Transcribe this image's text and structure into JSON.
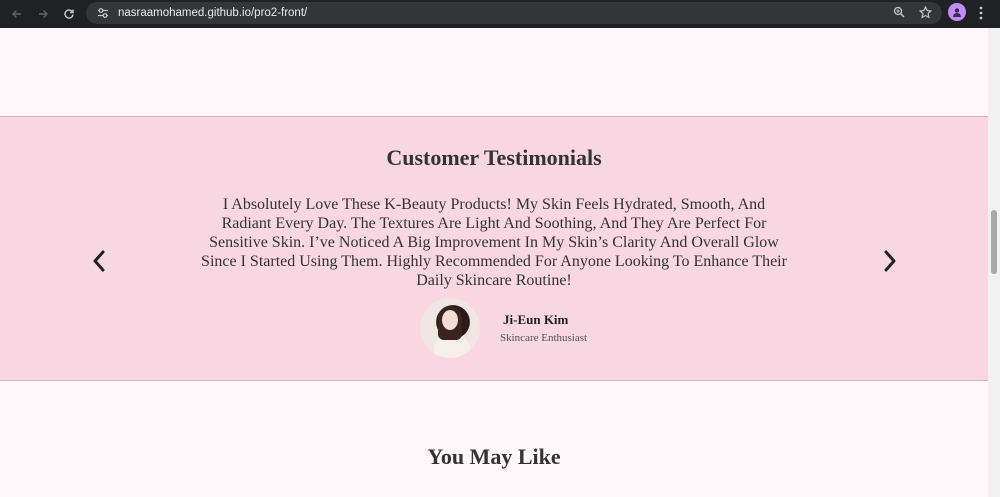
{
  "browser": {
    "url": "nasraamohamed.github.io/pro2-front/",
    "icons": {
      "back": "arrow-left-icon",
      "forward": "arrow-right-icon",
      "reload": "reload-icon",
      "site_info": "tune-icon",
      "zoom": "zoom-icon",
      "bookmark": "star-icon",
      "profile": "profile-icon",
      "menu": "kebab-menu-icon"
    },
    "colors": {
      "frame": "#202124",
      "omnibox": "#35363a",
      "profile": "#c58af9"
    }
  },
  "testimonials": {
    "title": "Customer Testimonials",
    "quote": "I Absolutely Love These K-Beauty Products! My Skin Feels Hydrated, Smooth, And Radiant Every Day. The Textures Are Light And Soothing, And They Are Perfect For Sensitive Skin. I’ve Noticed A Big Improvement In My Skin’s Clarity And Overall Glow Since I Started Using Them. Highly Recommended For Anyone Looking To Enhance Their Daily Skincare Routine!",
    "author_name": "Ji-Eun Kim",
    "author_role": "Skincare Enthusiast",
    "prev_icon": "chevron-left-icon",
    "next_icon": "chevron-right-icon",
    "background": "#f8d7e2"
  },
  "you_may_like": {
    "title": "You May Like"
  }
}
